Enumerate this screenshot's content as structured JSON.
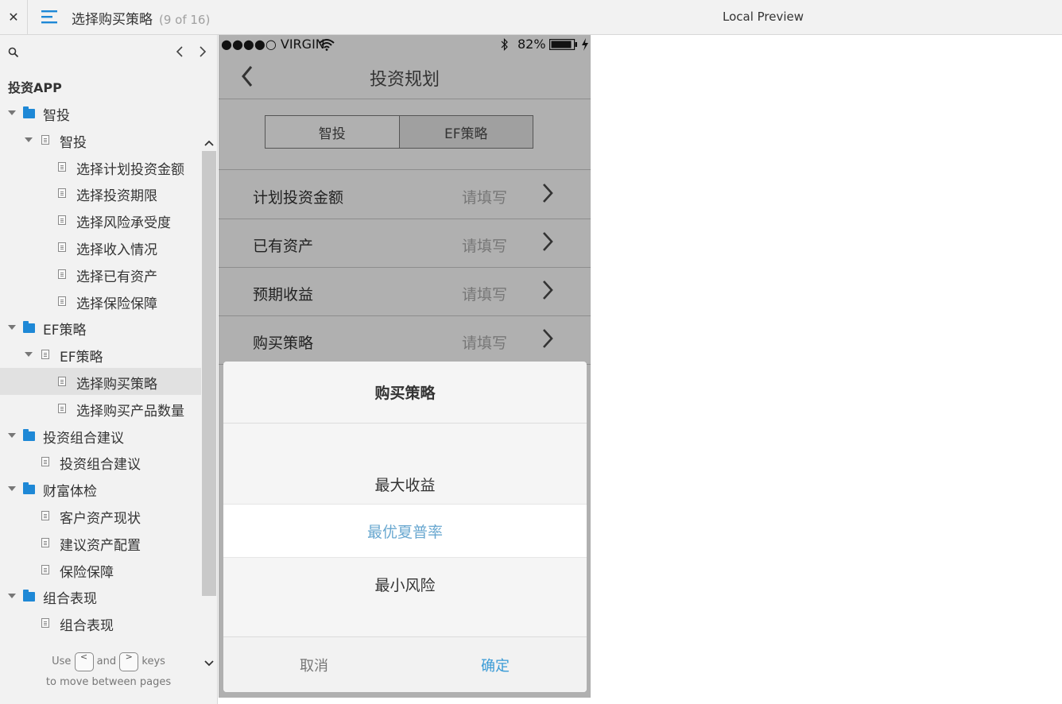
{
  "topbar": {
    "close_label": "✕",
    "title": "选择购买策略",
    "page_count": "(9 of 16)",
    "preview_label": "Local Preview"
  },
  "sidebar": {
    "project_title": "投资APP",
    "tree": [
      {
        "label": "智投",
        "type": "folder",
        "level": 0,
        "expanded": true
      },
      {
        "label": "智投",
        "type": "page",
        "level": 1,
        "expanded": true
      },
      {
        "label": "选择计划投资金额",
        "type": "page",
        "level": 2
      },
      {
        "label": "选择投资期限",
        "type": "page",
        "level": 2
      },
      {
        "label": "选择风险承受度",
        "type": "page",
        "level": 2
      },
      {
        "label": "选择收入情况",
        "type": "page",
        "level": 2
      },
      {
        "label": "选择已有资产",
        "type": "page",
        "level": 2
      },
      {
        "label": "选择保险保障",
        "type": "page",
        "level": 2
      },
      {
        "label": "EF策略",
        "type": "folder",
        "level": 0,
        "expanded": true
      },
      {
        "label": "EF策略",
        "type": "page",
        "level": 1,
        "expanded": true
      },
      {
        "label": "选择购买策略",
        "type": "page",
        "level": 2,
        "selected": true
      },
      {
        "label": "选择购买产品数量",
        "type": "page",
        "level": 2
      },
      {
        "label": "投资组合建议",
        "type": "folder",
        "level": 0,
        "expanded": true
      },
      {
        "label": "投资组合建议",
        "type": "page",
        "level": 1
      },
      {
        "label": "财富体检",
        "type": "folder",
        "level": 0,
        "expanded": true
      },
      {
        "label": "客户资产现状",
        "type": "page",
        "level": 1
      },
      {
        "label": "建议资产配置",
        "type": "page",
        "level": 1
      },
      {
        "label": "保险保障",
        "type": "page",
        "level": 1
      },
      {
        "label": "组合表现",
        "type": "folder",
        "level": 0,
        "expanded": true
      },
      {
        "label": "组合表现",
        "type": "page",
        "level": 1
      }
    ],
    "hint": {
      "use": "Use",
      "and": "and",
      "keys": "keys",
      "line2": "to move between pages",
      "prev_key": "<",
      "next_key": ">"
    }
  },
  "phone": {
    "status": {
      "carrier": "●●●●○ VIRGIN",
      "battery_pct": "82%"
    },
    "nav_title": "投资规划",
    "segments": [
      {
        "label": "智投",
        "active": false
      },
      {
        "label": "EF策略",
        "active": true
      }
    ],
    "rows": [
      {
        "label": "计划投资金额",
        "value": "请填写"
      },
      {
        "label": "已有资产",
        "value": "请填写"
      },
      {
        "label": "预期收益",
        "value": "请填写"
      },
      {
        "label": "购买策略",
        "value": "请填写"
      }
    ]
  },
  "sheet": {
    "title": "购买策略",
    "options": [
      {
        "label": "最大收益",
        "selected": false
      },
      {
        "label": "最优夏普率",
        "selected": true
      },
      {
        "label": "最小风险",
        "selected": false
      }
    ],
    "cancel_label": "取消",
    "confirm_label": "确定"
  },
  "colors": {
    "accent": "#3a9bd6",
    "folder": "#1e88d6",
    "selected_option": "#6aa8d0",
    "phone_bg": "#b0b0b0"
  }
}
